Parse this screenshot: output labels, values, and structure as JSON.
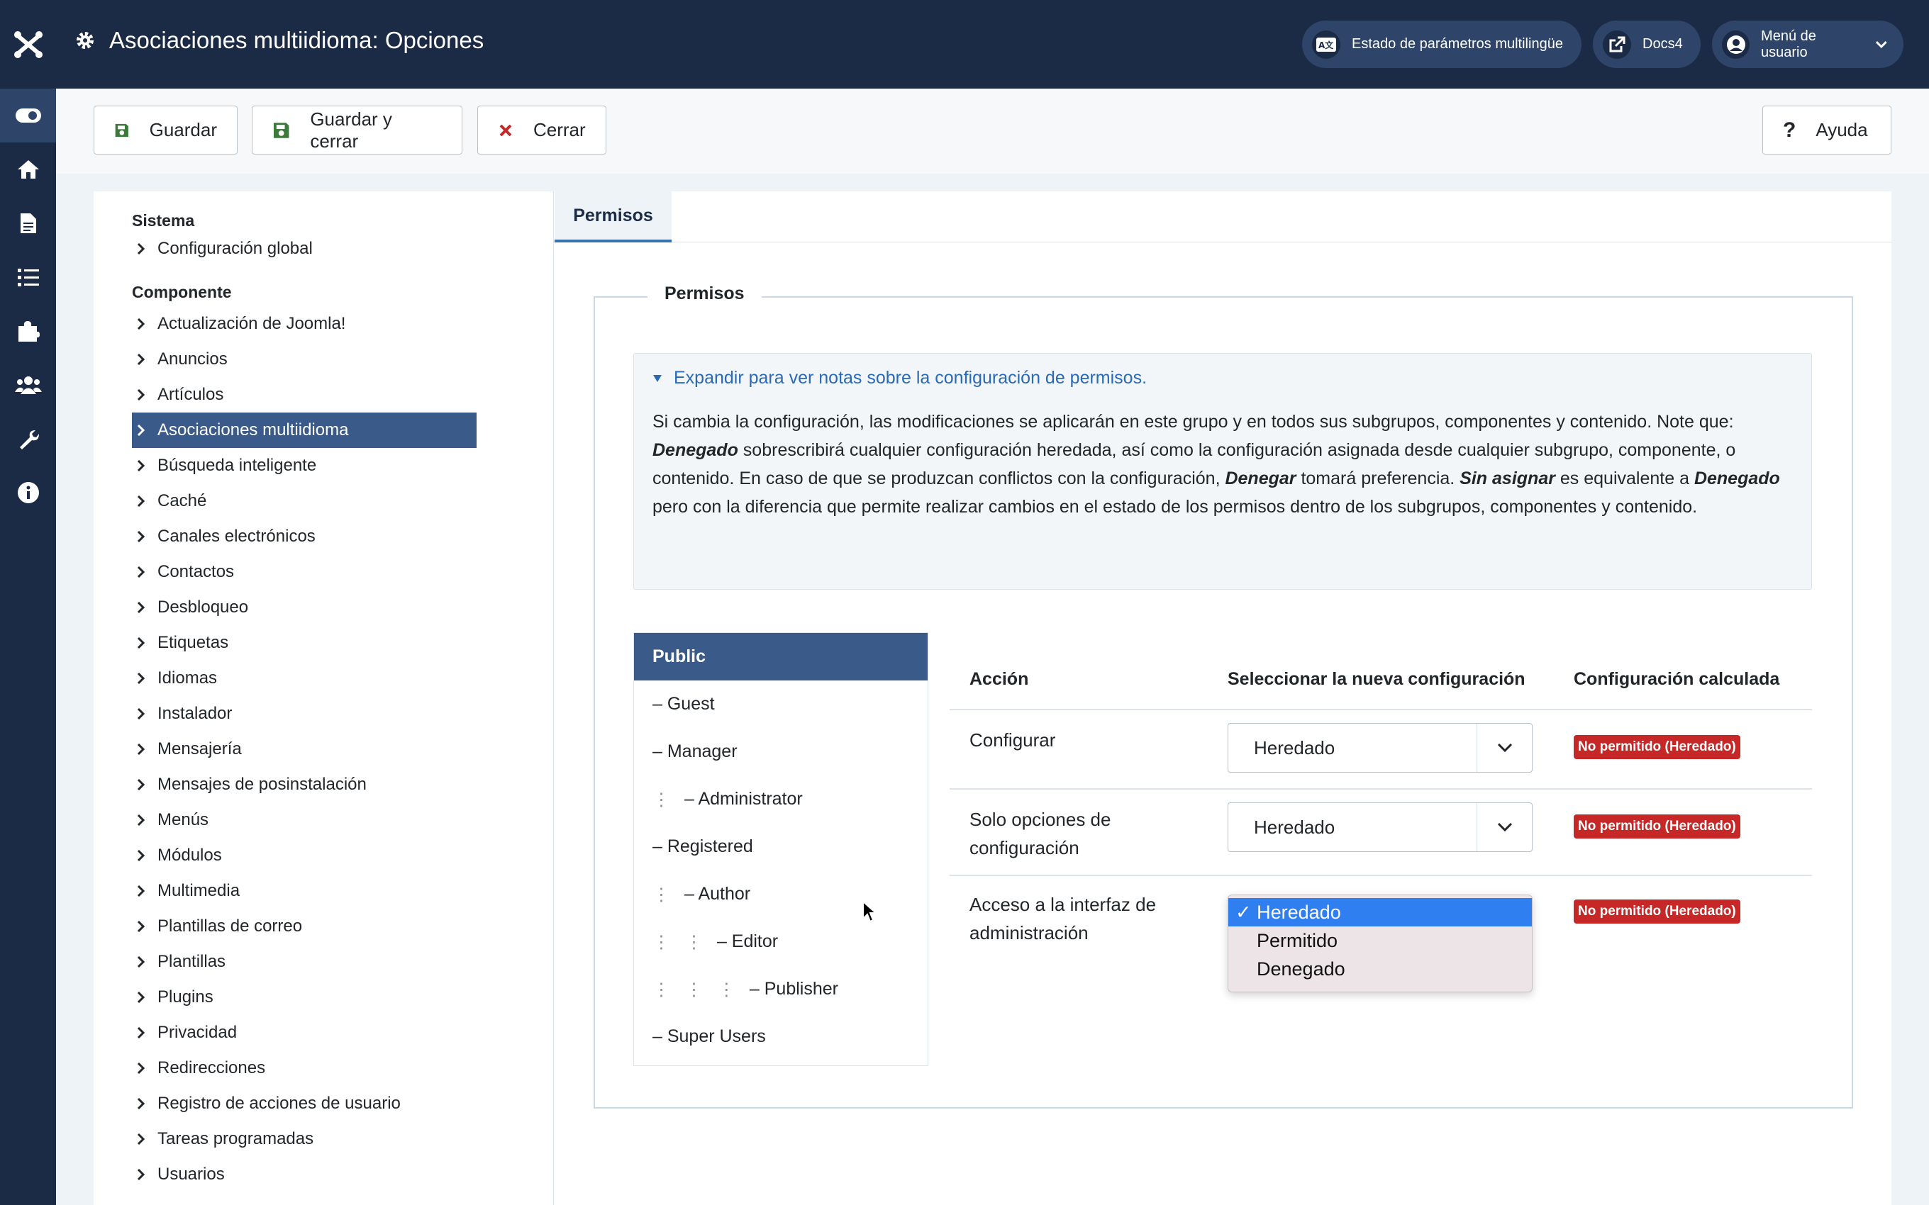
{
  "header": {
    "title": "Asociaciones multiidioma: Opciones",
    "buttons": {
      "multilang_status": "Estado de parámetros multilingüe",
      "docs": "Docs4",
      "user_menu": "Menú de usuario"
    }
  },
  "rail": {
    "icons": [
      "toggle-icon",
      "home-icon",
      "file-icon",
      "list-icon",
      "puzzle-icon",
      "users-icon",
      "wrench-icon",
      "info-icon"
    ]
  },
  "toolbar": {
    "save": "Guardar",
    "save_close": "Guardar y cerrar",
    "close": "Cerrar",
    "help": "Ayuda"
  },
  "nav": {
    "system_heading": "Sistema",
    "system_items": [
      "Configuración global"
    ],
    "component_heading": "Componente",
    "component_items": [
      "Actualización de Joomla!",
      "Anuncios",
      "Artículos",
      "Asociaciones multiidioma",
      "Búsqueda inteligente",
      "Caché",
      "Canales electrónicos",
      "Contactos",
      "Desbloqueo",
      "Etiquetas",
      "Idiomas",
      " Instalador",
      "Mensajería",
      "Mensajes de posinstalación",
      "Menús",
      "Módulos",
      "Multimedia",
      "Plantillas de correo",
      "Plantillas",
      "Plugins",
      "Privacidad",
      "Redirecciones",
      "Registro de acciones de usuario",
      "Tareas programadas",
      "Usuarios"
    ],
    "active_item": "Asociaciones multiidioma"
  },
  "main": {
    "tab": "Permisos",
    "legend": "Permisos",
    "notes_summary": "Expandir para ver notas sobre la configuración de permisos.",
    "notes": {
      "line1": "Si cambia la configuración, las modificaciones se aplicarán en este grupo y en todos sus subgrupos, componentes y contenido. Note que:",
      "b1": "Denegado",
      "t1": " sobrescribirá cualquier configuración heredada, así como la configuración asignada desde cualquier subgrupo, componente, o contenido. En caso de que se produzcan conflictos con la configuración, ",
      "b2": "Denegar",
      "t2": " tomará preferencia. ",
      "b3": "Sin asignar",
      "t3": " es equivalente a ",
      "b4": "Denegado",
      "t4": " pero con la diferencia que permite realizar cambios en el estado de los permisos dentro de los subgrupos, componentes y contenido."
    },
    "groups": [
      {
        "dots": "",
        "label": "Public"
      },
      {
        "dots": "",
        "label": "– Guest"
      },
      {
        "dots": "",
        "label": "– Manager"
      },
      {
        "dots": "⋮",
        "label": "– Administrator"
      },
      {
        "dots": "",
        "label": "– Registered"
      },
      {
        "dots": "⋮",
        "label": "– Author"
      },
      {
        "dots": "⋮ ⋮",
        "label": "– Editor"
      },
      {
        "dots": "⋮ ⋮ ⋮",
        "label": "– Publisher"
      },
      {
        "dots": "",
        "label": "– Super Users"
      }
    ],
    "table": {
      "headers": [
        "Acción",
        "Seleccionar la nueva configuración",
        "Configuración calculada"
      ],
      "rows": [
        {
          "action": "Configurar",
          "value": "Heredado",
          "calculated": "No permitido (Heredado)"
        },
        {
          "action": "Solo opciones de configuración",
          "value": "Heredado",
          "calculated": "No permitido (Heredado)"
        },
        {
          "action": "Acceso a la interfaz de administración",
          "value": "Heredado",
          "calculated": "No permitido (Heredado)"
        }
      ]
    },
    "dropdown_options": [
      "✓ Heredado",
      "Permitido",
      "Denegado"
    ],
    "dropdown_selected": "✓ Heredado"
  },
  "colors": {
    "header_bg": "#1c2b45",
    "active_nav": "#3a5b8a",
    "badge_red": "#c52827",
    "link_blue": "#2a69b8",
    "option_highlight": "#2f7ff1"
  }
}
